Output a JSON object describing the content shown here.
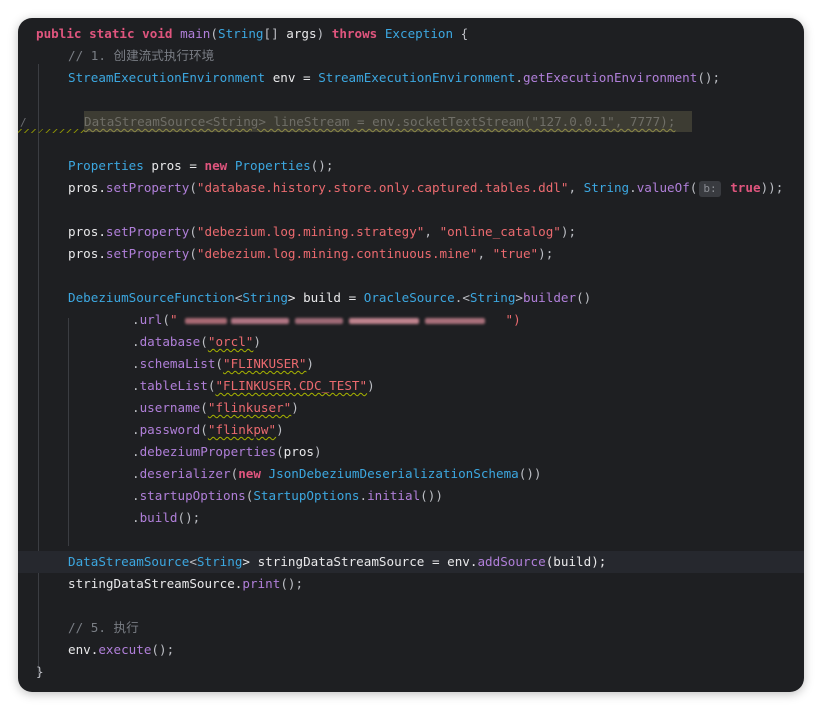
{
  "code": {
    "line_main": [
      {
        "t": "public static void ",
        "c": "kw"
      },
      {
        "t": "main",
        "c": "fn"
      },
      {
        "t": "(",
        "c": "pl"
      },
      {
        "t": "String",
        "c": "ty"
      },
      {
        "t": "[] ",
        "c": "pl"
      },
      {
        "t": "args",
        "c": "v"
      },
      {
        "t": ") ",
        "c": "pl"
      },
      {
        "t": "throws ",
        "c": "kw"
      },
      {
        "t": "Exception",
        "c": "ty"
      },
      {
        "t": " {",
        "c": "pl"
      }
    ],
    "comment_1": "// 1. 创建流式执行环境",
    "line_env": [
      {
        "t": "StreamExecutionEnvironment",
        "c": "ty"
      },
      {
        "t": " env = ",
        "c": "v"
      },
      {
        "t": "StreamExecutionEnvironment",
        "c": "ty"
      },
      {
        "t": ".",
        "c": "pl"
      },
      {
        "t": "getExecutionEnvironment",
        "c": "fn"
      },
      {
        "t": "();",
        "c": "pl"
      }
    ],
    "line_inactive": "DataStreamSource<String> lineStream = env.socketTextStream(\"127.0.0.1\", 7777);",
    "line_props": [
      {
        "t": "Properties",
        "c": "ty"
      },
      {
        "t": " pros = ",
        "c": "v"
      },
      {
        "t": "new ",
        "c": "kw"
      },
      {
        "t": "Properties",
        "c": "ty"
      },
      {
        "t": "();",
        "c": "pl"
      }
    ],
    "line_set1_pre": [
      {
        "t": "pros.",
        "c": "v"
      },
      {
        "t": "setProperty",
        "c": "fn"
      },
      {
        "t": "(",
        "c": "pl"
      },
      {
        "t": "\"database.history.store.only.captured.tables.ddl\"",
        "c": "str"
      },
      {
        "t": ", ",
        "c": "pl"
      },
      {
        "t": "String",
        "c": "ty"
      },
      {
        "t": ".",
        "c": "pl"
      },
      {
        "t": "valueOf",
        "c": "fn"
      },
      {
        "t": "(",
        "c": "pl"
      }
    ],
    "line_set1_hint": "b:",
    "line_set1_post": [
      {
        "t": " true",
        "c": "kw"
      },
      {
        "t": "));",
        "c": "pl"
      }
    ],
    "line_set2": [
      {
        "t": "pros.",
        "c": "v"
      },
      {
        "t": "setProperty",
        "c": "fn"
      },
      {
        "t": "(",
        "c": "pl"
      },
      {
        "t": "\"debezium.log.mining.strategy\"",
        "c": "str"
      },
      {
        "t": ", ",
        "c": "pl"
      },
      {
        "t": "\"online_catalog\"",
        "c": "str"
      },
      {
        "t": ");",
        "c": "pl"
      }
    ],
    "line_set3": [
      {
        "t": "pros.",
        "c": "v"
      },
      {
        "t": "setProperty",
        "c": "fn"
      },
      {
        "t": "(",
        "c": "pl"
      },
      {
        "t": "\"debezium.log.mining.continuous.mine\"",
        "c": "str"
      },
      {
        "t": ", ",
        "c": "pl"
      },
      {
        "t": "\"true\"",
        "c": "str"
      },
      {
        "t": ");",
        "c": "pl"
      }
    ],
    "line_build": [
      {
        "t": "DebeziumSourceFunction",
        "c": "ty"
      },
      {
        "t": "<",
        "c": "pl"
      },
      {
        "t": "String",
        "c": "ty"
      },
      {
        "t": "> build = ",
        "c": "v"
      },
      {
        "t": "OracleSource",
        "c": "ty"
      },
      {
        "t": ".<",
        "c": "pl"
      },
      {
        "t": "String",
        "c": "ty"
      },
      {
        "t": ">",
        "c": "pl"
      },
      {
        "t": "builder",
        "c": "fn"
      },
      {
        "t": "()",
        "c": "pl"
      }
    ],
    "url_pre": [
      {
        "t": ".",
        "c": "pl"
      },
      {
        "t": "url",
        "c": "fn"
      },
      {
        "t": "(",
        "c": "pl"
      },
      {
        "t": "\"",
        "c": "str"
      }
    ],
    "url_post": [
      {
        "t": "\")",
        "c": "str"
      }
    ],
    "line_database": [
      {
        "t": ".",
        "c": "pl"
      },
      {
        "t": "database",
        "c": "fn"
      },
      {
        "t": "(",
        "c": "pl"
      },
      {
        "t": "\"orcl\"",
        "c": "str squig"
      },
      {
        "t": ")",
        "c": "pl"
      }
    ],
    "line_schema": [
      {
        "t": ".",
        "c": "pl"
      },
      {
        "t": "schemaList",
        "c": "fn"
      },
      {
        "t": "(",
        "c": "pl"
      },
      {
        "t": "\"FLINKUSER\"",
        "c": "str squig"
      },
      {
        "t": ")",
        "c": "pl"
      }
    ],
    "line_table": [
      {
        "t": ".",
        "c": "pl"
      },
      {
        "t": "tableList",
        "c": "fn"
      },
      {
        "t": "(",
        "c": "pl"
      },
      {
        "t": "\"FLINKUSER.CDC_TEST\"",
        "c": "str squig"
      },
      {
        "t": ")",
        "c": "pl"
      }
    ],
    "line_username": [
      {
        "t": ".",
        "c": "pl"
      },
      {
        "t": "username",
        "c": "fn"
      },
      {
        "t": "(",
        "c": "pl"
      },
      {
        "t": "\"flinkuser\"",
        "c": "str squig"
      },
      {
        "t": ")",
        "c": "pl"
      }
    ],
    "line_password": [
      {
        "t": ".",
        "c": "pl"
      },
      {
        "t": "password",
        "c": "fn"
      },
      {
        "t": "(",
        "c": "pl"
      },
      {
        "t": "\"flinkpw\"",
        "c": "str squig"
      },
      {
        "t": ")",
        "c": "pl"
      }
    ],
    "line_debprops": [
      {
        "t": ".",
        "c": "pl"
      },
      {
        "t": "debeziumProperties",
        "c": "fn"
      },
      {
        "t": "(",
        "c": "pl"
      },
      {
        "t": "pros",
        "c": "v"
      },
      {
        "t": ")",
        "c": "pl"
      }
    ],
    "line_deser": [
      {
        "t": ".",
        "c": "pl"
      },
      {
        "t": "deserializer",
        "c": "fn"
      },
      {
        "t": "(",
        "c": "pl"
      },
      {
        "t": "new ",
        "c": "kw"
      },
      {
        "t": "JsonDebeziumDeserializationSchema",
        "c": "ty"
      },
      {
        "t": "())",
        "c": "pl"
      }
    ],
    "line_startup": [
      {
        "t": ".",
        "c": "pl"
      },
      {
        "t": "startupOptions",
        "c": "fn"
      },
      {
        "t": "(",
        "c": "pl"
      },
      {
        "t": "StartupOptions",
        "c": "ty"
      },
      {
        "t": ".",
        "c": "pl"
      },
      {
        "t": "initial",
        "c": "fn"
      },
      {
        "t": "())",
        "c": "pl"
      }
    ],
    "line_buildcall": [
      {
        "t": ".",
        "c": "pl"
      },
      {
        "t": "build",
        "c": "fn"
      },
      {
        "t": "();",
        "c": "pl"
      }
    ],
    "line_source": [
      {
        "t": "DataStreamSource",
        "c": "ty"
      },
      {
        "t": "<",
        "c": "pl"
      },
      {
        "t": "String",
        "c": "ty"
      },
      {
        "t": "> stringDataStreamSource = env.",
        "c": "v"
      },
      {
        "t": "addSource",
        "c": "fn"
      },
      {
        "t": "(build);",
        "c": "v"
      }
    ],
    "line_print": [
      {
        "t": "stringDataStreamSource.",
        "c": "v"
      },
      {
        "t": "print",
        "c": "fn"
      },
      {
        "t": "();",
        "c": "pl"
      }
    ],
    "comment_5": "// 5. 执行",
    "line_execute": [
      {
        "t": "env.",
        "c": "v"
      },
      {
        "t": "execute",
        "c": "fn"
      },
      {
        "t": "();",
        "c": "pl"
      }
    ],
    "closing_brace": "}"
  },
  "colors": {
    "background": "#1e1f22",
    "keyword": "#e0557e",
    "type": "#3ca7e0",
    "method": "#b07fd9",
    "string": "#eb6a6f",
    "comment": "#7a7e85"
  }
}
